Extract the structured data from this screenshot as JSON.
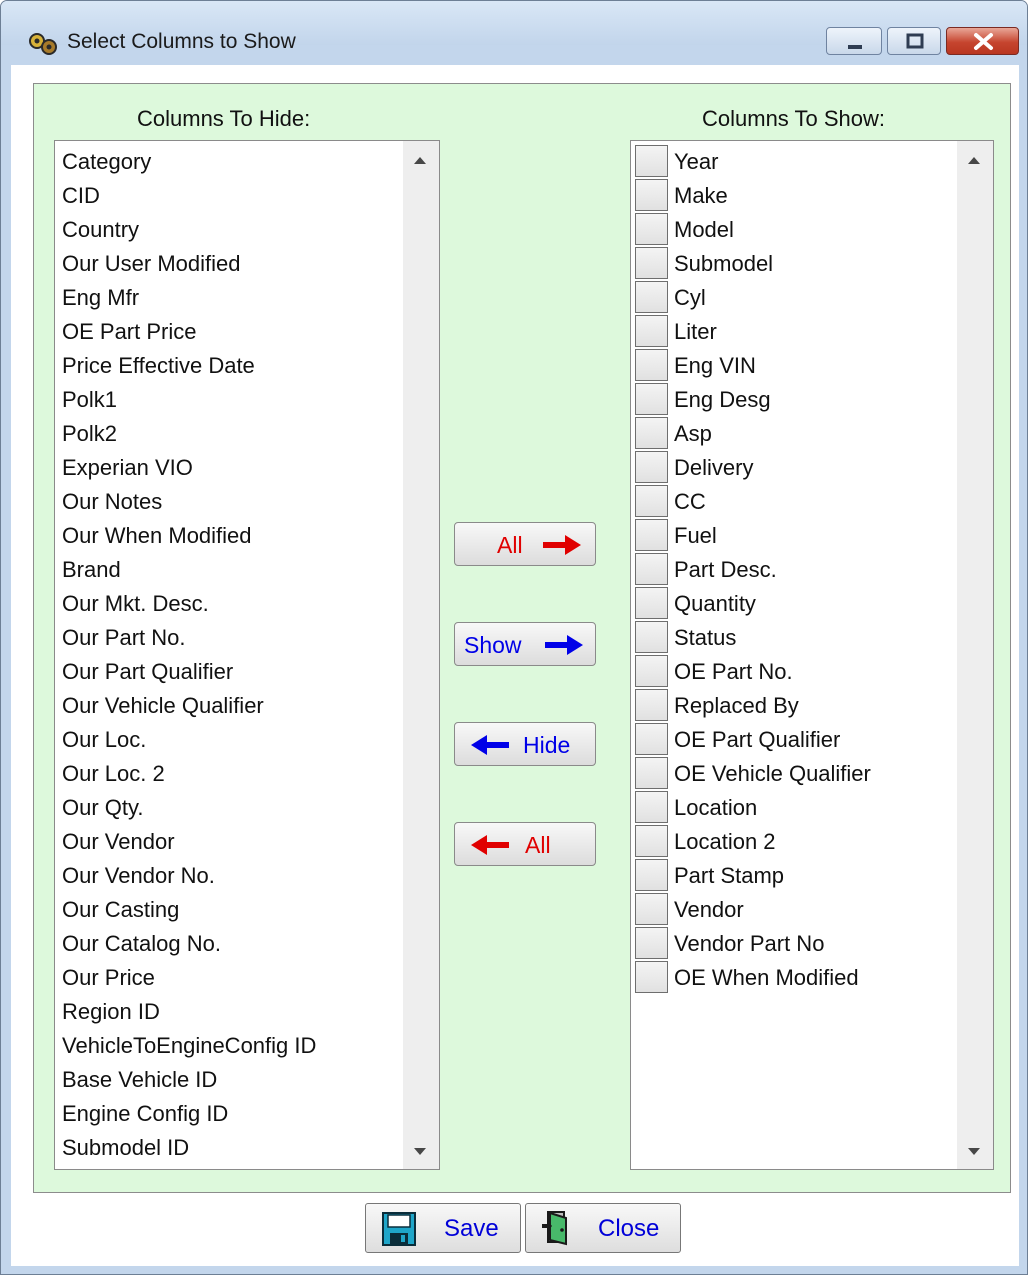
{
  "window": {
    "title": "Select Columns to Show",
    "icon": "app-gears-icon"
  },
  "hide_list": {
    "title": "Columns To Hide:",
    "items": [
      "Category",
      "CID",
      "Country",
      "Our User Modified",
      "Eng Mfr",
      "OE Part Price",
      "Price Effective Date",
      "Polk1",
      "Polk2",
      "Experian VIO",
      "Our Notes",
      "Our When Modified",
      "Brand",
      "Our Mkt. Desc.",
      "Our Part No.",
      "Our Part Qualifier",
      "Our Vehicle Qualifier",
      "Our Loc.",
      "Our Loc. 2",
      "Our Qty.",
      "Our Vendor",
      "Our Vendor No.",
      "Our Casting",
      "Our Catalog No.",
      "Our Price",
      "Region ID",
      "VehicleToEngineConfig ID",
      "Base Vehicle ID",
      "Engine Config ID",
      "Submodel ID"
    ]
  },
  "show_list": {
    "title": "Columns To Show:",
    "items": [
      "Year",
      "Make",
      "Model",
      "Submodel",
      "Cyl",
      "Liter",
      "Eng VIN",
      "Eng Desg",
      "Asp",
      "Delivery",
      "CC",
      "Fuel",
      "Part Desc.",
      "Quantity",
      "Status",
      "OE Part No.",
      "Replaced By",
      "OE Part Qualifier",
      "OE Vehicle Qualifier",
      "Location",
      "Location 2",
      "Part Stamp",
      "Vendor",
      "Vendor Part No",
      "OE When Modified"
    ]
  },
  "buttons": {
    "all_right": "All",
    "show": "Show",
    "hide": "Hide",
    "all_left": "All",
    "save": "Save",
    "close": "Close"
  },
  "colors": {
    "panel_bg": "#DDF9DC",
    "arrow_red": "#E00000",
    "arrow_blue": "#0000E8",
    "close_red": "#C6452F"
  }
}
